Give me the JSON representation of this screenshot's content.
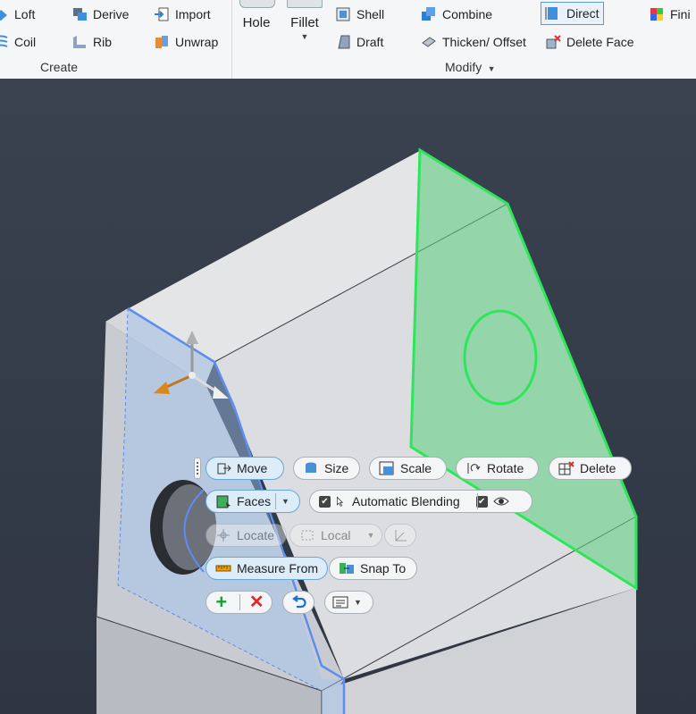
{
  "ribbon": {
    "create": {
      "loft": "Loft",
      "coil": "Coil",
      "derive": "Derive",
      "rib": "Rib",
      "import": "Import",
      "unwrap": "Unwrap",
      "label": "Create"
    },
    "modify": {
      "hole": "Hole",
      "fillet": "Fillet",
      "shell": "Shell",
      "draft": "Draft",
      "combine": "Combine",
      "thicken": "Thicken/ Offset",
      "direct": "Direct",
      "delete_face": "Delete Face",
      "label": "Modify"
    },
    "cut_off": "Fini"
  },
  "minitoolbar": {
    "move": "Move",
    "size": "Size",
    "scale": "Scale",
    "rotate": "Rotate",
    "delete": "Delete",
    "faces": "Faces",
    "automatic_blending": "Automatic Blending",
    "locate": "Locate",
    "local": "Local",
    "measure_from": "Measure From",
    "snap_to": "Snap To"
  },
  "icons": [
    "loft-icon",
    "coil-icon",
    "derive-icon",
    "rib-icon",
    "import-icon",
    "unwrap-icon",
    "hole-icon",
    "fillet-icon",
    "shell-icon",
    "draft-icon",
    "combine-icon",
    "thicken-icon",
    "direct-icon",
    "delete-face-icon",
    "move-icon",
    "size-icon",
    "scale-icon",
    "rotate-icon",
    "delete-icon",
    "faces-icon",
    "cursor-icon",
    "eye-icon",
    "locate-icon",
    "local-icon",
    "ruler-icon",
    "snap-icon",
    "plus-icon",
    "x-icon",
    "undo-icon",
    "menu-icon"
  ],
  "colors": {
    "highlight_green": "#2ee65a",
    "selection_blue": "#5b8ef0",
    "viewport_bg": "#3a4250"
  }
}
